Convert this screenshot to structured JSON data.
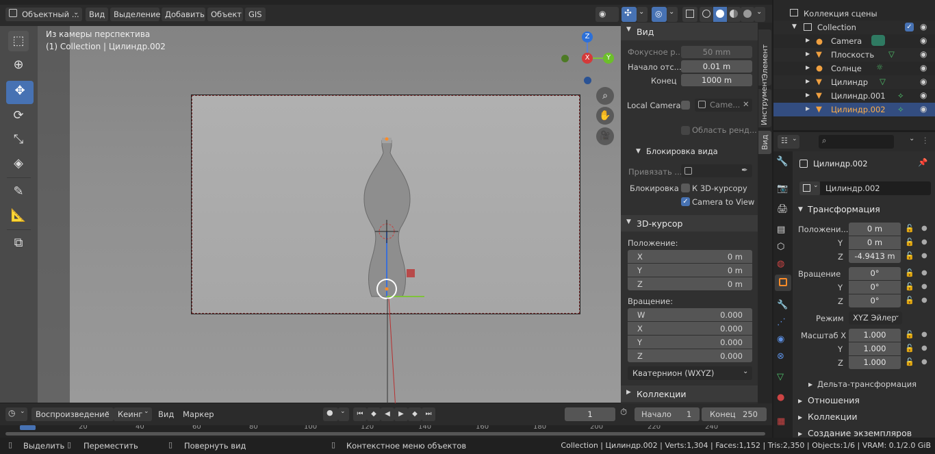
{
  "header": {
    "mode": "Объектный ...",
    "menus": [
      "Вид",
      "Выделение",
      "Добавить",
      "Объект",
      "GIS"
    ]
  },
  "viewport": {
    "overlay_title": "Из камеры перспектива",
    "overlay_sub": "(1) Collection | Цилиндр.002",
    "gizmo": {
      "z": "Z",
      "x": "X",
      "y": "Y"
    }
  },
  "npanel": {
    "tabs": [
      "Элемент",
      "Инструмент",
      "Вид"
    ],
    "view_header": "Вид",
    "focal_label": "Фокусное р...",
    "focal_value": "50 mm",
    "clip_start_label": "Начало отс...",
    "clip_start_value": "0.01 m",
    "clip_end_label": "Конец",
    "clip_end_value": "1000 m",
    "local_camera_label": "Local Camera",
    "local_camera_value": "Came...",
    "render_region_label": "Область ренд...",
    "lock_header": "Блокировка вида",
    "lock_to_label": "Привязать ...",
    "lock_label": "Блокировка",
    "lock_cursor_label": "К 3D-курсору",
    "camera_to_view_label": "Camera to View",
    "cursor_header": "3D-курсор",
    "location_label": "Положение:",
    "loc": [
      {
        "axis": "X",
        "value": "0 m"
      },
      {
        "axis": "Y",
        "value": "0 m"
      },
      {
        "axis": "Z",
        "value": "0 m"
      }
    ],
    "rotation_label": "Вращение:",
    "rot": [
      {
        "axis": "W",
        "value": "0.000"
      },
      {
        "axis": "X",
        "value": "0.000"
      },
      {
        "axis": "Y",
        "value": "0.000"
      },
      {
        "axis": "Z",
        "value": "0.000"
      }
    ],
    "rot_mode": "Кватернион (WXYZ)",
    "collections_header": "Коллекции"
  },
  "outliner": {
    "scene_collection": "Коллекция сцены",
    "collection": "Collection",
    "items": [
      "Camera",
      "Плоскость",
      "Солнце",
      "Цилиндр",
      "Цилиндр.001",
      "Цилиндр.002"
    ]
  },
  "properties": {
    "object_name": "Цилиндр.002",
    "name_field": "Цилиндр.002",
    "transform_header": "Трансформация",
    "location_label": "Положени...",
    "loc": [
      {
        "axis": "",
        "value": "0 m"
      },
      {
        "axis": "Y",
        "value": "0 m"
      },
      {
        "axis": "Z",
        "value": "-4.9413 m"
      }
    ],
    "rotation_label": "Вращение",
    "rot": [
      {
        "axis": "",
        "value": "0°"
      },
      {
        "axis": "Y",
        "value": "0°"
      },
      {
        "axis": "Z",
        "value": "0°"
      }
    ],
    "mode_label": "Режим",
    "mode_value": "XYZ Эйлер",
    "scale_label": "Масштаб X",
    "scale": [
      {
        "axis": "",
        "value": "1.000"
      },
      {
        "axis": "Y",
        "value": "1.000"
      },
      {
        "axis": "Z",
        "value": "1.000"
      }
    ],
    "delta": "Дельта-трансформация",
    "relations": "Отношения",
    "collections": "Коллекции",
    "instancing": "Создание экземпляров"
  },
  "timeline": {
    "playback": "Воспроизведение",
    "keying": "Кеинг",
    "view": "Вид",
    "marker": "Маркер",
    "current_frame": "1",
    "start_label": "Начало",
    "start_value": "1",
    "end_label": "Конец",
    "end_value": "250",
    "ticks": [
      "1",
      "20",
      "40",
      "60",
      "80",
      "100",
      "120",
      "140",
      "160",
      "180",
      "200",
      "220",
      "240"
    ]
  },
  "status": {
    "select": "Выделить",
    "move": "Переместить",
    "rotate": "Повернуть вид",
    "context": "Контекстное меню объектов",
    "stats": "Collection | Цилиндр.002 | Verts:1,304 | Faces:1,152 | Tris:2,350 | Objects:1/6 | VRAM: 0.1/2.0 GiB"
  },
  "colors": {
    "accent": "#4772b3",
    "selected_row": "#334d80",
    "object_orange": "#ff8c28"
  }
}
